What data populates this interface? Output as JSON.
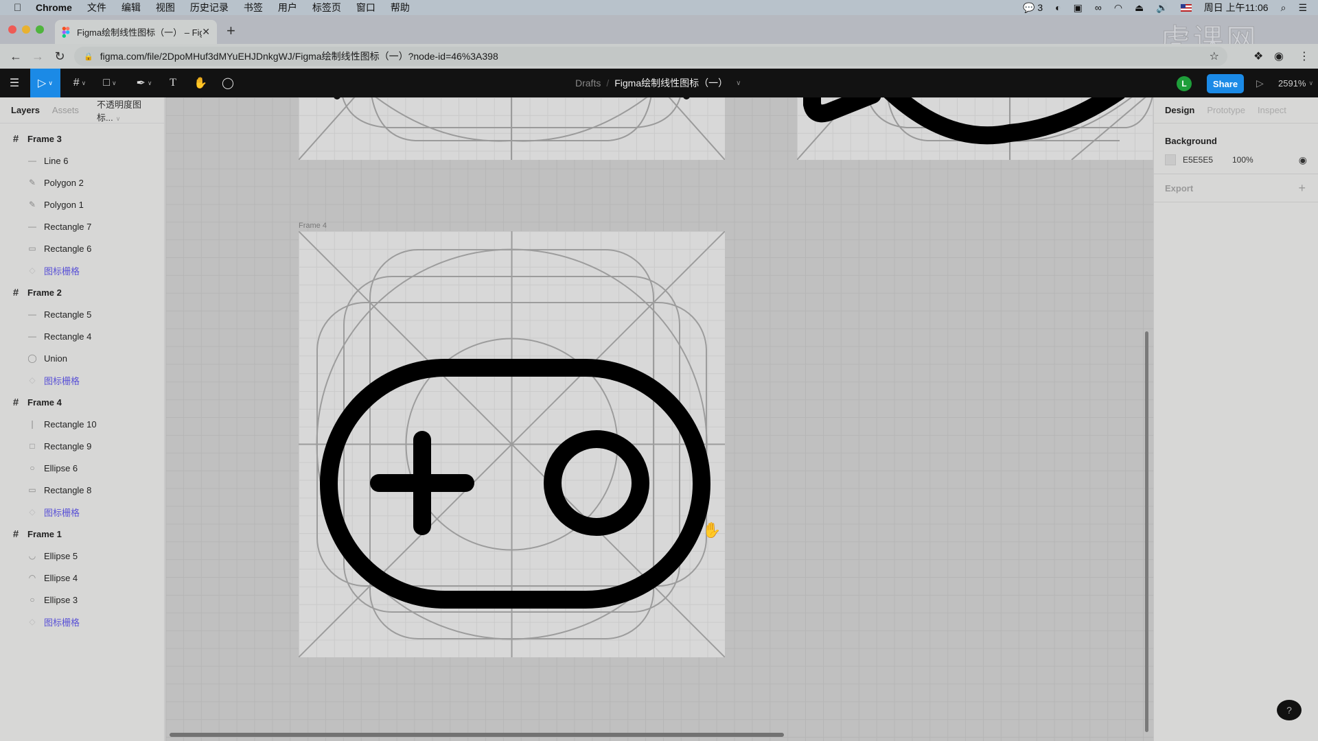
{
  "menubar": {
    "items": [
      "Chrome",
      "文件",
      "编辑",
      "视图",
      "历史记录",
      "书签",
      "用户",
      "标签页",
      "窗口",
      "帮助"
    ],
    "wechat_count": "3",
    "clock": "周日 上午11:06"
  },
  "browser": {
    "tab_title": "Figma绘制线性图标（一） – Figma",
    "url": "figma.com/file/2DpoMHuf3dMYuEHJDnkgWJ/Figma绘制线性图标（一）?node-id=46%3A398",
    "watermark": "虎课网"
  },
  "toolbar": {
    "breadcrumb_root": "Drafts",
    "breadcrumb_sep": "/",
    "file_name": "Figma绘制线性图标（一）",
    "avatar_initial": "L",
    "share_label": "Share",
    "zoom_level": "2591%"
  },
  "left_panel": {
    "tabs": [
      "Layers",
      "Assets"
    ],
    "page_name": "不透明度图标...",
    "layers": [
      {
        "name": "Frame 3",
        "type": "frame",
        "icon": "frame-icon"
      },
      {
        "name": "Line 6",
        "type": "child",
        "icon": "line-icon"
      },
      {
        "name": "Polygon 2",
        "type": "child",
        "icon": "vector-icon"
      },
      {
        "name": "Polygon 1",
        "type": "child",
        "icon": "vector-icon"
      },
      {
        "name": "Rectangle 7",
        "type": "child",
        "icon": "line-icon"
      },
      {
        "name": "Rectangle 6",
        "type": "child",
        "icon": "rectangle-icon"
      },
      {
        "name": "图标栅格",
        "type": "component",
        "icon": "instance-icon"
      },
      {
        "name": "Frame 2",
        "type": "frame",
        "icon": "frame-icon"
      },
      {
        "name": "Rectangle 5",
        "type": "child",
        "icon": "line-icon"
      },
      {
        "name": "Rectangle 4",
        "type": "child",
        "icon": "line-icon"
      },
      {
        "name": "Union",
        "type": "child",
        "icon": "union-icon"
      },
      {
        "name": "图标栅格",
        "type": "component",
        "icon": "instance-icon"
      },
      {
        "name": "Frame 4",
        "type": "frame",
        "icon": "frame-icon"
      },
      {
        "name": "Rectangle 10",
        "type": "child",
        "icon": "vertical-line-icon"
      },
      {
        "name": "Rectangle 9",
        "type": "child",
        "icon": "square-icon"
      },
      {
        "name": "Ellipse 6",
        "type": "child",
        "icon": "ellipse-icon"
      },
      {
        "name": "Rectangle 8",
        "type": "child",
        "icon": "rectangle-icon"
      },
      {
        "name": "图标栅格",
        "type": "component",
        "icon": "instance-icon"
      },
      {
        "name": "Frame 1",
        "type": "frame",
        "icon": "frame-icon"
      },
      {
        "name": "Ellipse 5",
        "type": "child",
        "icon": "arc-bottom-icon"
      },
      {
        "name": "Ellipse 4",
        "type": "child",
        "icon": "arc-top-icon"
      },
      {
        "name": "Ellipse 3",
        "type": "child",
        "icon": "ellipse-icon"
      },
      {
        "name": "图标栅格",
        "type": "component",
        "icon": "instance-icon"
      }
    ]
  },
  "canvas": {
    "frame_label": "Frame 4"
  },
  "right_panel": {
    "tabs": [
      "Design",
      "Prototype",
      "Inspect"
    ],
    "background_title": "Background",
    "background_hex": "E5E5E5",
    "background_opacity": "100%",
    "export_title": "Export"
  },
  "colors": {
    "accent": "#1b8ae6",
    "component": "#5a52d6",
    "avatar": "#1e9e3a"
  },
  "help_label": "?"
}
